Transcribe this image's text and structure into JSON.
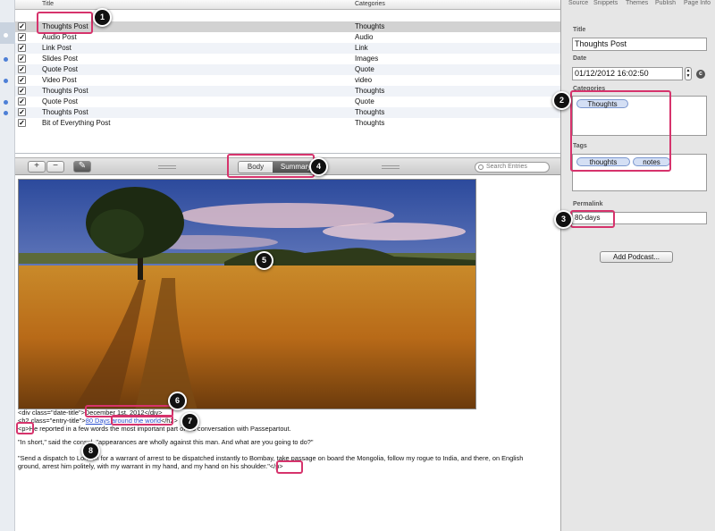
{
  "list": {
    "columns": {
      "title": "Title",
      "categories": "Categories"
    },
    "rows": [
      {
        "title": "Thoughts Post",
        "category": "Thoughts"
      },
      {
        "title": "Audio Post",
        "category": "Audio"
      },
      {
        "title": "Link Post",
        "category": "Link"
      },
      {
        "title": "Slides Post",
        "category": "Images"
      },
      {
        "title": "Quote Post",
        "category": "Quote"
      },
      {
        "title": "Video Post",
        "category": "video"
      },
      {
        "title": "Thoughts Post",
        "category": "Thoughts"
      },
      {
        "title": "Quote Post",
        "category": "Quote"
      },
      {
        "title": "Thoughts Post",
        "category": "Thoughts"
      },
      {
        "title": "Bit of Everything Post",
        "category": "Thoughts"
      }
    ]
  },
  "toolbar": {
    "add_label": "+",
    "remove_label": "−",
    "edit_label": "✎",
    "body_label": "Body",
    "summary_label": "Summary",
    "search_placeholder": "Search Entries"
  },
  "content": {
    "line1_pre": "<div class=\"date-title\">",
    "line1_date": "December 1st, 2012",
    "line1_post": "</div>",
    "line2_pre": "<h2 class=\"entry-title\">",
    "line2_link": "80 Days around the world",
    "line2_post": "</h2>",
    "line3_tag": "<p>",
    "line3_text": "He reported in a few words the most important part of his conversation with Passepartout.",
    "line4": "\"In short,\" said the consul, \"appearances are wholly against this man. And what are you going to do?\"",
    "line5": "\"Send a dispatch to London for a warrant of arrest to be dispatched instantly to Bombay, take passage on board the Mongolia, follow my rogue to India, and there, on English",
    "line6_text": "ground, arrest him politely, with my warrant in my hand, and my hand on his shoulder.\"",
    "line6_tag": "</p>"
  },
  "inspector": {
    "tabs": [
      "Source",
      "Snippets",
      "Themes",
      "Publish",
      "Page Info"
    ],
    "title_label": "Title",
    "title_value": "Thoughts Post",
    "date_label": "Date",
    "date_value": "01/12/2012 16:02:50",
    "categories_label": "Categories",
    "categories": [
      "Thoughts"
    ],
    "tags_label": "Tags",
    "tags": [
      "thoughts",
      "notes"
    ],
    "permalink_label": "Permalink",
    "permalink_value": "80-days",
    "podcast_label": "Add Podcast..."
  },
  "markers": [
    "1",
    "2",
    "3",
    "4",
    "5",
    "6",
    "7",
    "8"
  ],
  "colors": {
    "annotation": "#d6336c",
    "selection": "#d2d2d2",
    "pill": "#d4dff4"
  }
}
